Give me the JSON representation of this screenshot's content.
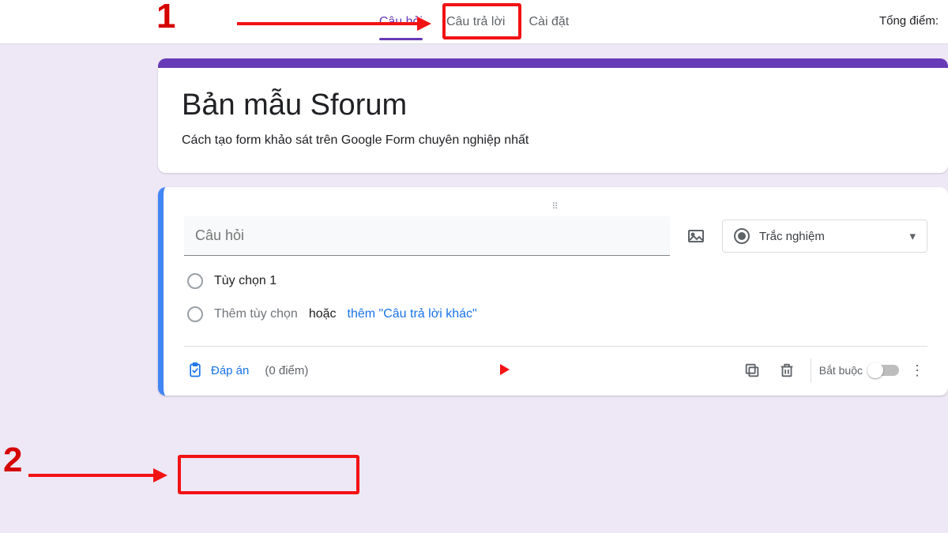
{
  "tabs": {
    "questions": "Câu hỏi",
    "responses": "Câu trả lời",
    "settings": "Cài đặt"
  },
  "total_score_label": "Tổng điểm:",
  "form": {
    "title": "Bản mẫu Sforum",
    "description": "Cách tạo form khảo sát trên Google Form chuyên nghiệp nhất"
  },
  "question": {
    "placeholder": "Câu hỏi",
    "type_label": "Trắc nghiệm",
    "option1": "Tùy chọn 1",
    "add_option": "Thêm tùy chọn",
    "or": "hoặc",
    "add_other": "thêm \"Câu trả lời khác\"",
    "answer_key": "Đáp án",
    "points": "(0 điểm)",
    "required": "Bắt buộc"
  },
  "annotations": {
    "one": "1",
    "two": "2"
  }
}
